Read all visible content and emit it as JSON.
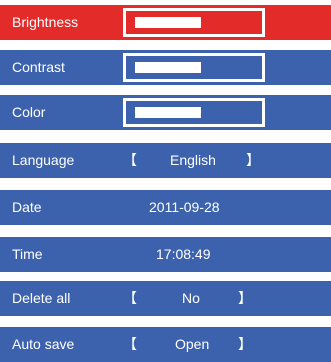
{
  "menu": {
    "selected_index": 0,
    "items": [
      {
        "label": "Brightness",
        "type": "slider",
        "level": 0.6
      },
      {
        "label": "Contrast",
        "type": "slider",
        "level": 0.6
      },
      {
        "label": "Color",
        "type": "slider",
        "level": 0.6
      },
      {
        "label": "Language",
        "type": "option",
        "bracket_open": "【",
        "value": "English",
        "bracket_close": "】"
      },
      {
        "label": "Date",
        "type": "text",
        "value": "2011-09-28"
      },
      {
        "label": "Time",
        "type": "text",
        "value": "17:08:49"
      },
      {
        "label": "Delete all",
        "type": "option",
        "bracket_open": "【",
        "value": "No",
        "bracket_close": "】"
      },
      {
        "label": "Auto save",
        "type": "option",
        "bracket_open": "【",
        "value": "Open",
        "bracket_close": "】"
      }
    ]
  },
  "colors": {
    "row_background": "#3c62ad",
    "row_selected": "#e32b2a",
    "text": "#ffffff"
  }
}
